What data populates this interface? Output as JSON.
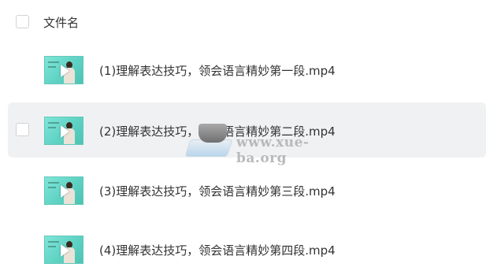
{
  "header": {
    "column_label": "文件名"
  },
  "files": [
    {
      "name": "(1)理解表达技巧，领会语言精妙第一段.mp4",
      "icon": "video-thumbnail-icon",
      "hovered": false
    },
    {
      "name": "(2)理解表达技巧，领会语言精妙第二段.mp4",
      "icon": "video-thumbnail-icon",
      "hovered": true
    },
    {
      "name": "(3)理解表达技巧，领会语言精妙第三段.mp4",
      "icon": "video-thumbnail-icon",
      "hovered": false
    },
    {
      "name": "(4)理解表达技巧，领会语言精妙第四段.mp4",
      "icon": "video-thumbnail-icon",
      "hovered": false
    }
  ],
  "watermark": {
    "text": "www.xue-ba.org"
  },
  "colors": {
    "hover_row_bg": "#f0f1f3",
    "text": "#333333",
    "thumbnail_teal": "#5fd2c4"
  }
}
